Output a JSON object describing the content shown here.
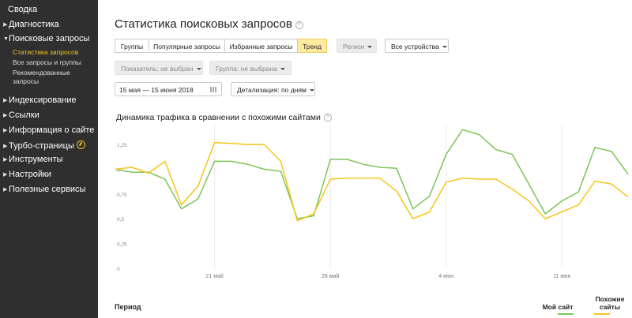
{
  "sidebar": {
    "summary": "Сводка",
    "items": [
      {
        "label": "Диагностика"
      },
      {
        "label": "Поисковые запросы"
      },
      {
        "label": "Индексирование"
      },
      {
        "label": "Ссылки"
      },
      {
        "label": "Информация о сайте"
      },
      {
        "label": "Турбо-страницы"
      },
      {
        "label": "Инструменты"
      },
      {
        "label": "Настройки"
      },
      {
        "label": "Полезные сервисы"
      }
    ],
    "subitems": [
      {
        "label": "Статистика запросов"
      },
      {
        "label": "Все запросы и группы"
      },
      {
        "label": "Рекомендованные"
      },
      {
        "label": "запросы"
      }
    ]
  },
  "main": {
    "title": "Статистика поисковых запросов",
    "tabs": [
      "Группы",
      "Популярные запросы",
      "Избранные запросы",
      "Тренд"
    ],
    "active_tab": "Тренд",
    "region": "Регион",
    "devices": "Все устройства",
    "metric": "Показатель: не выбран",
    "group": "Группа: не выбрана",
    "date_range": "15 мая — 15 июня 2018",
    "detail": "Детализация: по дням",
    "chart_title": "Динамика трафика в сравнении с похожими сайтами",
    "footer_period": "Период",
    "footer_my": "Мой сайт",
    "footer_similar_1": "Похожие",
    "footer_similar_2": "сайты"
  },
  "colors": {
    "my_site": "#7cc55a",
    "similar": "#f5c518",
    "active_tab": "#ffeba0"
  },
  "chart_data": {
    "type": "line",
    "x_labels": [
      "21 май",
      "28 май",
      "4 июн",
      "11 июн"
    ],
    "y_ticks": [
      "0",
      "0,25",
      "0,5",
      "0,75",
      "1",
      "1,25"
    ],
    "ylim": [
      0,
      1.45
    ],
    "series": [
      {
        "name": "Мой сайт",
        "color": "#7cc55a",
        "values": [
          1,
          0.97,
          0.97,
          0.9,
          0.6,
          0.7,
          1.08,
          1.08,
          1.05,
          1.0,
          0.98,
          0.5,
          0.53,
          1.1,
          1.1,
          1.05,
          1.02,
          1.01,
          0.6,
          0.73,
          1.15,
          1.4,
          1.35,
          1.2,
          1.15,
          0.85,
          0.55,
          0.68,
          0.77,
          1.22,
          1.18,
          0.95
        ]
      },
      {
        "name": "Похожие сайты",
        "color": "#f5c518",
        "values": [
          1,
          1.02,
          0.96,
          1.08,
          0.64,
          0.83,
          1.27,
          1.26,
          1.25,
          1.25,
          1.08,
          0.48,
          0.55,
          0.9,
          0.91,
          0.91,
          0.91,
          0.78,
          0.5,
          0.57,
          0.87,
          0.91,
          0.9,
          0.9,
          0.8,
          0.68,
          0.5,
          0.57,
          0.64,
          0.88,
          0.85,
          0.72
        ]
      }
    ]
  }
}
